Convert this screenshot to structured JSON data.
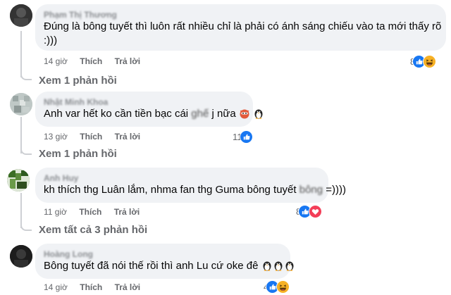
{
  "comments": [
    {
      "author": "Phạm Thị Thương",
      "text_line1": "Đúng là bông tuyết thì luôn rất nhiều chỉ là phải có ánh sáng chiếu vào ta mới thấy rõ",
      "text_line2": ":)))",
      "time": "14 giờ",
      "like_label": "Thích",
      "reply_label": "Trả lời",
      "reaction_count": "8",
      "reactions": [
        "like",
        "haha"
      ],
      "view_replies": "Xem 1 phản hồi"
    },
    {
      "author": "Nhật Minh Khoa",
      "text_pre": "Anh var hết ko cần tiền bạc cái",
      "text_hidden": "ghế",
      "text_post": "j nữa",
      "time": "13 giờ",
      "like_label": "Thích",
      "reply_label": "Trả lời",
      "reaction_count": "11",
      "reactions": [
        "like"
      ],
      "view_replies": "Xem 1 phản hồi"
    },
    {
      "author": "Anh Huy",
      "text_pre": "kh thích thg Luân lắm, nhma fan thg Guma bông tuyết",
      "text_hidden": "bông",
      "text_post": "=))))",
      "time": "11 giờ",
      "like_label": "Thích",
      "reply_label": "Trả lời",
      "reaction_count": "8",
      "reactions": [
        "like",
        "love"
      ],
      "view_replies": "Xem tất cả 3 phản hồi"
    },
    {
      "author": "Hoàng Long",
      "text_pre": "Bông tuyết đã nói thế rồi thì anh Lu cứ oke đê",
      "time": "14 giờ",
      "like_label": "Thích",
      "reply_label": "Trả lời",
      "reaction_count": "4",
      "reactions": [
        "like",
        "haha"
      ]
    }
  ],
  "colors": {
    "bubble": "#f0f2f5",
    "meta": "#65676b",
    "like": "#1877f2",
    "love": "#f33e58",
    "haha": "#f7b125",
    "thread_line": "#ced0d4"
  }
}
